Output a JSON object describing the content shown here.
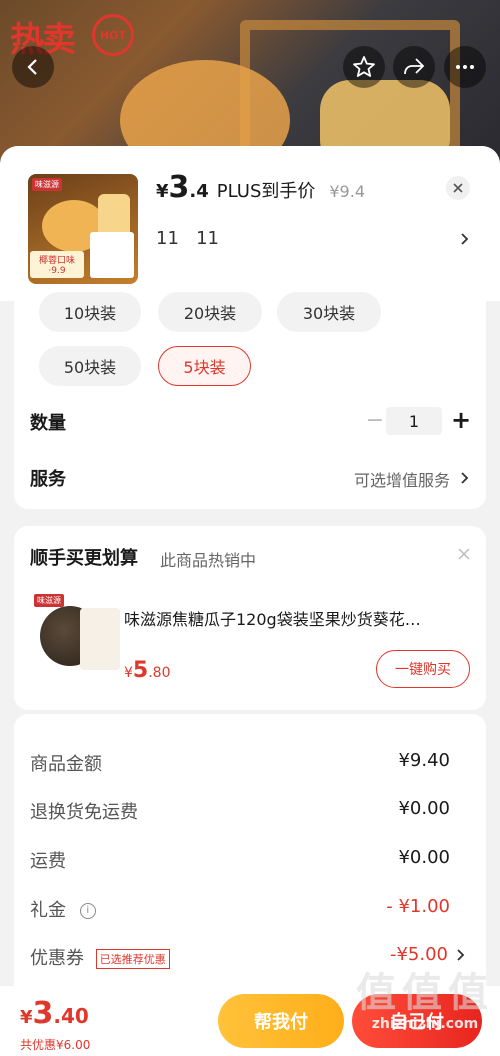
{
  "header": {
    "hot_text": "热卖",
    "hot_badge": "HOT",
    "back_icon": "chevron-left-icon",
    "favorite_icon": "star-icon",
    "share_icon": "share-icon",
    "more_icon": "more-dots-icon"
  },
  "product": {
    "currency": "¥",
    "price_int": "3",
    "price_dec": ".4",
    "plus_label": "PLUS到手价",
    "original_price": "¥9.4",
    "close_icon": "close-icon",
    "selected_spec": "11   11",
    "thumb_badge": "味滋源",
    "thumb_label": "椰蓉口味\n·9.9"
  },
  "specs": {
    "options": [
      "10块装",
      "20块装",
      "30块装",
      "50块装",
      "5块装"
    ],
    "selected": "5块装"
  },
  "quantity": {
    "label": "数量",
    "minus": "−",
    "value": "1",
    "plus": "+"
  },
  "service": {
    "label": "服务",
    "value": "可选增值服务"
  },
  "addon": {
    "title": "顺手买更划算",
    "subtitle": "此商品热销中",
    "item_name": "味滋源焦糖瓜子120g袋装坚果炒货葵花…",
    "item_brand": "味滋源",
    "price_symbol": "¥",
    "price_int": "5",
    "price_dec": ".80",
    "buy_label": "一键购买"
  },
  "summary": {
    "rows": [
      {
        "label": "商品金额",
        "value": "¥9.40"
      },
      {
        "label": "退换货免运费",
        "value": "¥0.00"
      },
      {
        "label": "运费",
        "value": "¥0.00"
      },
      {
        "label": "礼金",
        "value": "- ¥1.00"
      },
      {
        "label": "优惠券",
        "value": "-¥5.00"
      }
    ],
    "coupon_tag": "已选推荐优惠"
  },
  "footer": {
    "currency": "¥",
    "total_int": "3",
    "total_dec": ".40",
    "discount_text": "共优惠¥6.00",
    "help_pay": "帮我付",
    "self_pay": "自己付"
  },
  "watermark": {
    "big": "值值值",
    "small": "zhizhizhi.com"
  },
  "colors": {
    "accent": "#e0372c",
    "help_button": "#ffb829",
    "pay_button": "#ec2c22"
  }
}
